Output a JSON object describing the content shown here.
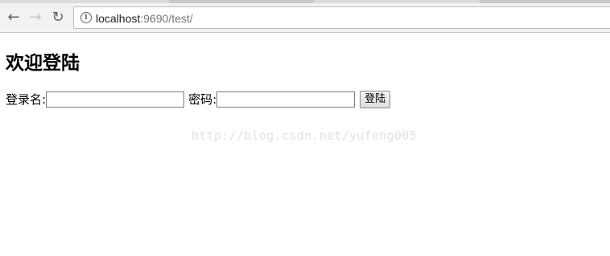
{
  "browser": {
    "url_host": "localhost",
    "url_rest": ":9690/test/"
  },
  "page": {
    "heading": "欢迎登陆",
    "username_label": "登录名:",
    "username_value": "",
    "password_label": "密码:",
    "password_value": "",
    "login_button": "登陆"
  },
  "watermark": "http://blog.csdn.net/yufeng005",
  "icons": {
    "back": "arrow-left",
    "forward": "arrow-right",
    "reload": "refresh",
    "site_info": "info-circle"
  }
}
